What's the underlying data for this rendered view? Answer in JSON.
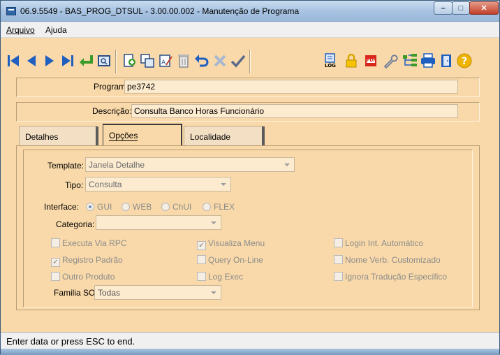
{
  "window": {
    "title": "06.9.5549 - BAS_PROG_DTSUL - 3.00.00.002 - Manutenção de Programa"
  },
  "menu": {
    "arquivo": "Arquivo",
    "ajuda": "Ajuda"
  },
  "toolbar": {
    "icons": [
      "first-icon",
      "prev-icon",
      "next-icon",
      "last-icon",
      "goto-icon",
      "search-icon",
      "add-icon",
      "copy-icon",
      "edit-icon",
      "delete-icon",
      "undo-icon",
      "cancel-icon",
      "save-icon",
      "log-icon",
      "lock-icon",
      "pdf-icon",
      "tool-icon",
      "tree-icon",
      "print-icon",
      "exit-icon",
      "help-icon"
    ],
    "log_label": "LOG",
    "pdf_label": "PDF"
  },
  "form": {
    "programa_label": "Programa:",
    "programa_value": "pe3742",
    "descricao_label": "Descrição:",
    "descricao_value": "Consulta Banco Horas Funcionário"
  },
  "tabs": [
    "Detalhes",
    "Opções",
    "Localidade"
  ],
  "options": {
    "template_label": "Template:",
    "template_value": "Janela Detalhe",
    "tipo_label": "Tipo:",
    "tipo_value": "Consulta",
    "interface_label": "Interface:",
    "interface_options": [
      "GUI",
      "WEB",
      "ChUI",
      "FLEX"
    ],
    "interface_selected": "GUI",
    "categoria_label": "Categoria:",
    "categoria_value": "",
    "checkboxes": {
      "executa_rpc": {
        "label": "Executa Via RPC",
        "checked": false
      },
      "visualiza_menu": {
        "label": "Visualiza Menu",
        "checked": true
      },
      "login_int": {
        "label": "Login Int. Automático",
        "checked": false
      },
      "registro_padrao": {
        "label": "Registro Padrão",
        "checked": true
      },
      "query_online": {
        "label": "Query On-Line",
        "checked": false
      },
      "nome_verb": {
        "label": "Nome Verb. Customizado",
        "checked": false
      },
      "outro_produto": {
        "label": "Outro Produto",
        "checked": false
      },
      "log_exec": {
        "label": "Log Exec",
        "checked": false
      },
      "ignora_traducao": {
        "label": "Ignora Tradução Específico",
        "checked": false
      }
    },
    "familia_label": "Familia SO:",
    "familia_value": "Todas"
  },
  "status": {
    "text": "Enter data or press ESC to end."
  },
  "colors": {
    "background": "#f9d9a9",
    "field": "#fdebd0",
    "toolbar_blue": "#1f5fbf"
  }
}
